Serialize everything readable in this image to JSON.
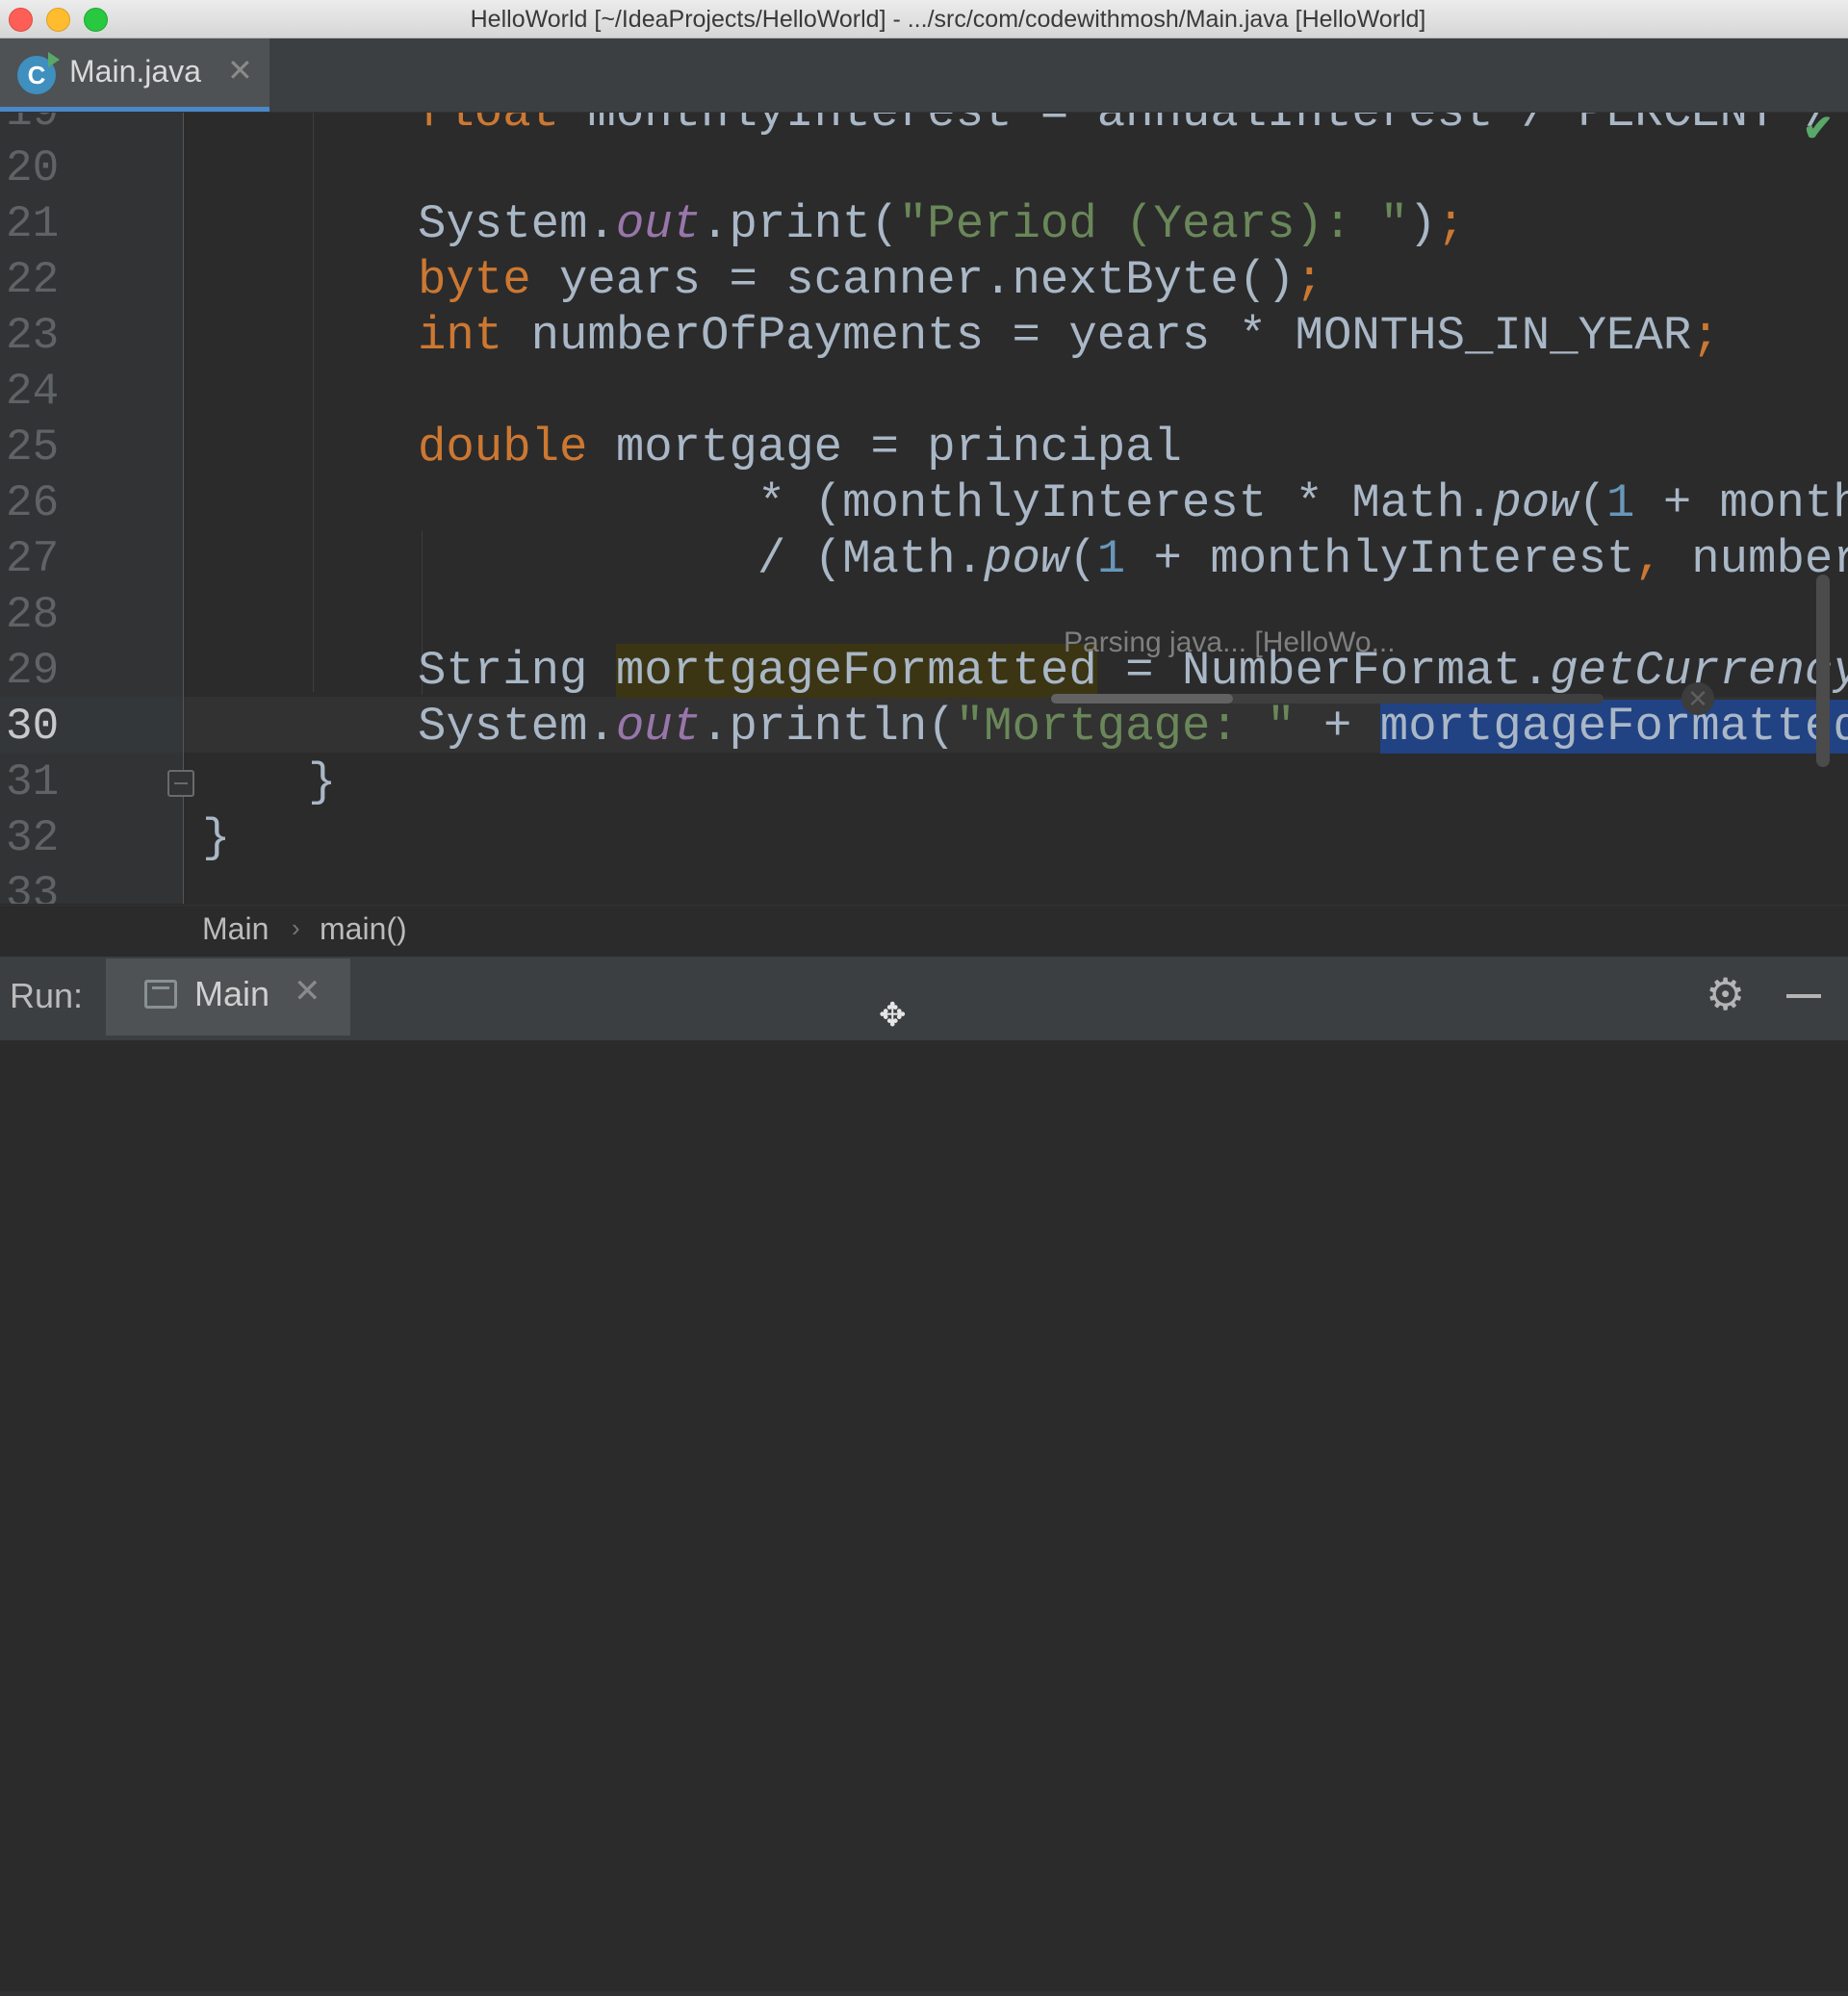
{
  "window": {
    "title": "HelloWorld [~/IdeaProjects/HelloWorld] - .../src/com/codewithmosh/Main.java [HelloWorld]"
  },
  "tabs": [
    {
      "label": "Main.java",
      "icon": "java-class-icon",
      "close": "✕"
    }
  ],
  "editor": {
    "current_line": 30,
    "lines": [
      {
        "num": "19",
        "segments": [
          {
            "t": "float",
            "c": "kw"
          },
          {
            "t": " monthlyInterest = annualInterest / PERCENT / MO",
            "c": ""
          }
        ]
      },
      {
        "num": "20",
        "segments": []
      },
      {
        "num": "21",
        "segments": [
          {
            "t": "System.",
            "c": ""
          },
          {
            "t": "out",
            "c": "fld"
          },
          {
            "t": ".print(",
            "c": ""
          },
          {
            "t": "\"Period (Years): \"",
            "c": "str"
          },
          {
            "t": ")",
            "c": ""
          },
          {
            "t": ";",
            "c": "kw"
          }
        ]
      },
      {
        "num": "22",
        "segments": [
          {
            "t": "byte",
            "c": "kw"
          },
          {
            "t": " years = scanner.nextByte()",
            "c": ""
          },
          {
            "t": ";",
            "c": "kw"
          }
        ]
      },
      {
        "num": "23",
        "segments": [
          {
            "t": "int",
            "c": "kw"
          },
          {
            "t": " numberOfPayments = years * MONTHS_IN_YEAR",
            "c": ""
          },
          {
            "t": ";",
            "c": "kw"
          }
        ]
      },
      {
        "num": "24",
        "segments": []
      },
      {
        "num": "25",
        "segments": [
          {
            "t": "double",
            "c": "kw"
          },
          {
            "t": " mortgage = principal",
            "c": ""
          }
        ]
      },
      {
        "num": "26",
        "segments": [
          {
            "t": "            * (monthlyInterest * Math.",
            "c": ""
          },
          {
            "t": "pow",
            "c": "ital"
          },
          {
            "t": "(",
            "c": ""
          },
          {
            "t": "1",
            "c": "num"
          },
          {
            "t": " + monthlyI",
            "c": ""
          }
        ]
      },
      {
        "num": "27",
        "segments": [
          {
            "t": "            / (Math.",
            "c": ""
          },
          {
            "t": "pow",
            "c": "ital"
          },
          {
            "t": "(",
            "c": ""
          },
          {
            "t": "1",
            "c": "num"
          },
          {
            "t": " + monthlyInterest",
            "c": ""
          },
          {
            "t": ",",
            "c": "kw"
          },
          {
            "t": " numberOfP",
            "c": ""
          }
        ]
      },
      {
        "num": "28",
        "segments": []
      },
      {
        "num": "29",
        "segments": [
          {
            "t": "String ",
            "c": ""
          },
          {
            "t": "mortgageFormatted",
            "c": "usage"
          },
          {
            "t": " = NumberFormat.",
            "c": ""
          },
          {
            "t": "getCurrencyIns",
            "c": "ital"
          }
        ]
      },
      {
        "num": "30",
        "segments": [
          {
            "t": "System.",
            "c": ""
          },
          {
            "t": "out",
            "c": "fld"
          },
          {
            "t": ".println(",
            "c": ""
          },
          {
            "t": "\"Mortgage: \"",
            "c": "str"
          },
          {
            "t": " + ",
            "c": ""
          },
          {
            "t": "mortgageFormatted",
            "c": "sel"
          },
          {
            "t": ");",
            "c": ""
          }
        ]
      },
      {
        "num": "31",
        "segments": [
          {
            "t": "}",
            "c": ""
          }
        ]
      },
      {
        "num": "32",
        "segments": [
          {
            "t": "}",
            "c": ""
          }
        ]
      },
      {
        "num": "33",
        "segments": []
      }
    ]
  },
  "progress": {
    "text": "Parsing java... [HelloWo...",
    "fraction": 0.33,
    "cancel_icon": "close-circle-icon"
  },
  "breadcrumbs": {
    "items": [
      "Main",
      "main()"
    ],
    "separator": "›"
  },
  "run_panel": {
    "label": "Run:",
    "tab_label": "Main",
    "tab_close": "✕",
    "settings_icon": "gear-icon",
    "minimize_icon": "minimize-icon"
  },
  "colors": {
    "keyword": "#cc7832",
    "string": "#6a8759",
    "number": "#6897bb",
    "field": "#9876aa",
    "text": "#a9b7c6",
    "selection": "#214283"
  }
}
